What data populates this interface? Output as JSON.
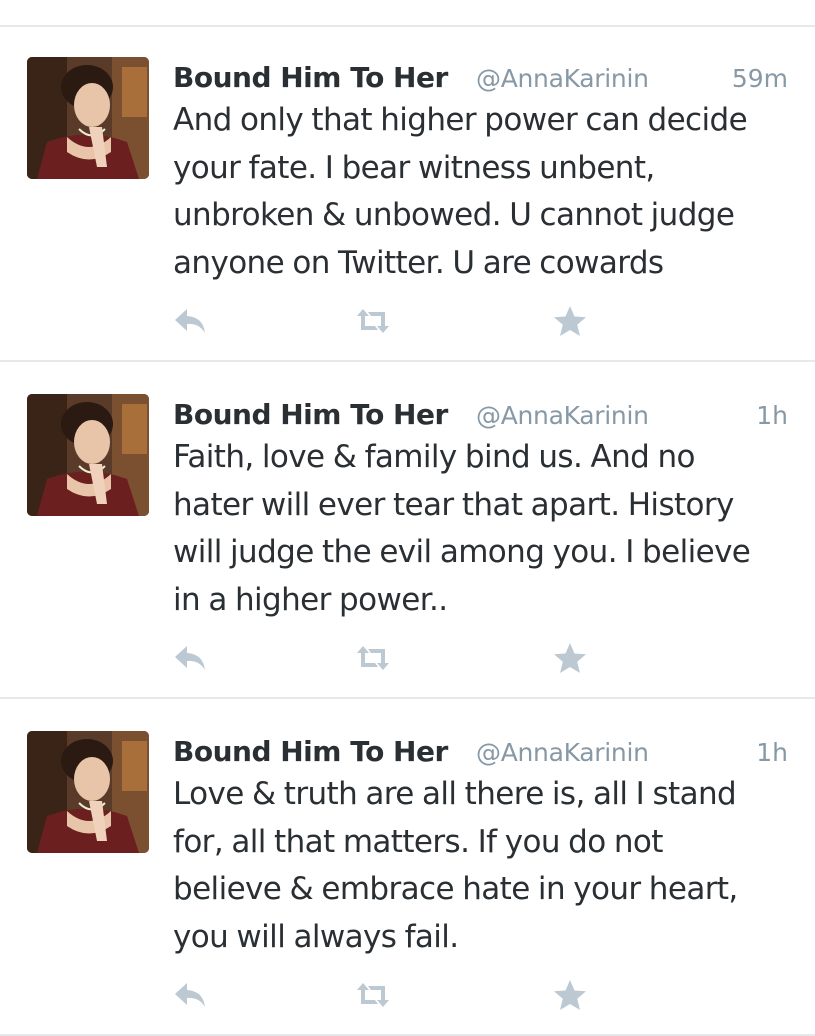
{
  "colors": {
    "text": "#292f33",
    "meta": "#8899a6",
    "action_icon": "#bcc8d2",
    "divider": "#e6e9eb"
  },
  "tweets": [
    {
      "name": "Bound Him To Her",
      "handle": "@AnnaKarinin",
      "time": "59m",
      "lines": [
        "And only that higher power can decide",
        "your fate. I bear witness unbent,",
        "unbroken & unbowed. U cannot judge",
        "anyone on Twitter. U are cowards"
      ],
      "actions": [
        "reply-icon",
        "retweet-icon",
        "favorite-star-icon"
      ]
    },
    {
      "name": "Bound Him To Her",
      "handle": "@AnnaKarinin",
      "time": "1h",
      "lines": [
        "Faith, love & family bind us. And no",
        "hater will ever tear that apart. History",
        "will judge the evil among you. I believe",
        "in a higher power.."
      ],
      "actions": [
        "reply-icon",
        "retweet-icon",
        "favorite-star-icon"
      ]
    },
    {
      "name": "Bound Him To Her",
      "handle": "@AnnaKarinin",
      "time": "1h",
      "lines": [
        "Love & truth are all there is, all I stand",
        "for, all that matters. If you do not",
        "believe & embrace hate in your heart,",
        "you will always fail."
      ],
      "actions": [
        "reply-icon",
        "retweet-icon",
        "favorite-star-icon"
      ]
    }
  ]
}
